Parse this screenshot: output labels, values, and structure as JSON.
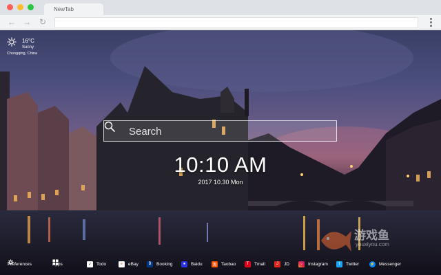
{
  "browser": {
    "tab_title": "NewTab",
    "address": ""
  },
  "weather": {
    "temperature": "16°C",
    "condition": "Sunny",
    "location": "Chongqing,  China",
    "icon": "sun-icon"
  },
  "search": {
    "placeholder": "Search",
    "icon": "search-icon"
  },
  "clock": {
    "time": "10:10 AM",
    "date": "2017 10.30 Mon"
  },
  "bottom_bar": {
    "items": [
      {
        "label": "Preferences",
        "icon": "gear-icon"
      },
      {
        "label": "Apps",
        "icon": "grid-icon"
      },
      {
        "label": "Todo",
        "icon": "check-icon"
      },
      {
        "label": "eBay",
        "icon": "ebay-icon"
      },
      {
        "label": "Booking",
        "icon": "booking-icon"
      },
      {
        "label": "Baidu",
        "icon": "baidu-icon"
      },
      {
        "label": "Taobao",
        "icon": "taobao-icon"
      },
      {
        "label": "Tmall",
        "icon": "tmall-icon"
      },
      {
        "label": "JD",
        "icon": "jd-icon"
      },
      {
        "label": "Instagram",
        "icon": "instagram-icon"
      },
      {
        "label": "Twitter",
        "icon": "twitter-icon"
      },
      {
        "label": "Messenger",
        "icon": "messenger-icon"
      }
    ]
  },
  "watermark": {
    "text": "游戏鱼",
    "sub": "youxiyou.com"
  }
}
